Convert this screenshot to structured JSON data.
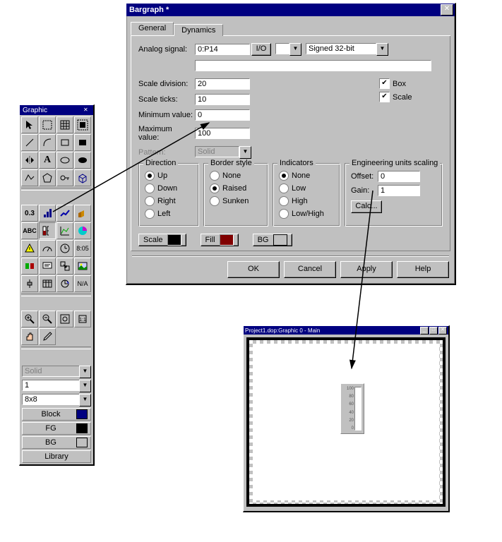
{
  "dialog": {
    "title": "Bargraph *",
    "tabs": {
      "general": "General",
      "dynamics": "Dynamics"
    },
    "labels": {
      "analog_signal": "Analog signal:",
      "scale_division": "Scale division:",
      "scale_ticks": "Scale ticks:",
      "minimum_value": "Minimum value:",
      "maximum_value": "Maximum value:",
      "pattern": "Pattern:"
    },
    "values": {
      "analog_signal": "0:P14",
      "io_button": "I/O",
      "datatype": "Signed 32-bit",
      "scale_division": "20",
      "scale_ticks": "10",
      "minimum_value": "0",
      "maximum_value": "100",
      "pattern": "Solid"
    },
    "checkboxes": {
      "box": "Box",
      "scale": "Scale"
    },
    "groups": {
      "direction": {
        "legend": "Direction",
        "options": {
          "up": "Up",
          "down": "Down",
          "right": "Right",
          "left": "Left"
        }
      },
      "border": {
        "legend": "Border style",
        "options": {
          "none": "None",
          "raised": "Raised",
          "sunken": "Sunken"
        }
      },
      "indicators": {
        "legend": "Indicators",
        "options": {
          "none": "None",
          "low": "Low",
          "high": "High",
          "lowhigh": "Low/High"
        }
      },
      "eng": {
        "legend": "Engineering units scaling",
        "offset_label": "Offset:",
        "offset_value": "0",
        "gain_label": "Gain:",
        "gain_value": "1",
        "calc_button": "Calc..."
      }
    },
    "color_buttons": {
      "scale": "Scale",
      "fill": "Fill",
      "bg": "BG"
    },
    "colors": {
      "scale": "#000000",
      "fill": "#800000",
      "bg": "#c0c0c0"
    },
    "buttons": {
      "ok": "OK",
      "cancel": "Cancel",
      "apply": "Apply",
      "help": "Help"
    }
  },
  "toolbox": {
    "title": "Graphic",
    "combos": {
      "pattern": "Solid",
      "linewidth": "1",
      "gridsize": "8x8"
    },
    "colorbtns": {
      "block": "Block",
      "fg": "FG",
      "bg": "BG"
    },
    "colors": {
      "block": "#000080",
      "fg": "#000000",
      "bg": "#c0c0c0"
    },
    "library": "Library",
    "tool_labels": {
      "t03": "0.3",
      "tABC": "ABC",
      "tA": "A",
      "tNA": "N/A",
      "t805": "8:05"
    }
  },
  "preview": {
    "title": "Project1.dop:Graphic 0 - Main",
    "scale_values": [
      "100",
      "80",
      "60",
      "40",
      "20",
      "0"
    ]
  }
}
